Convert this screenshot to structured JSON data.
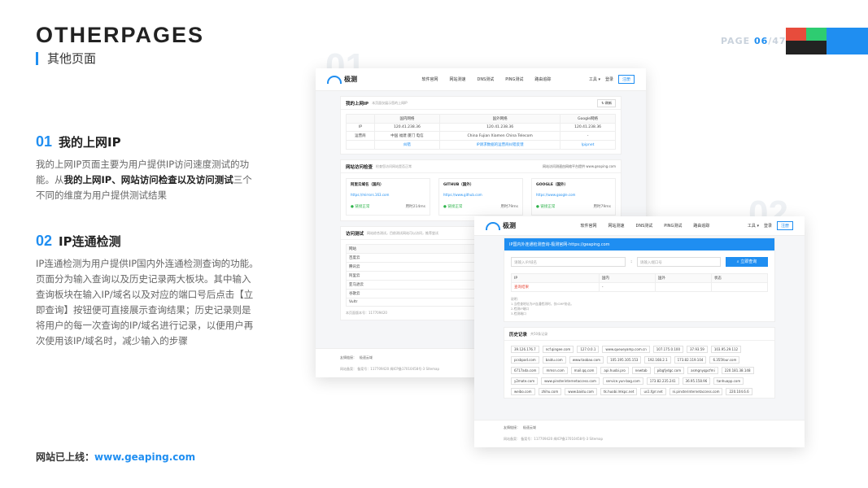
{
  "header": {
    "title_a": "OTHER",
    "title_b": "PAGES",
    "subtitle": "其他页面",
    "page_label": "PAGE",
    "page_current": "06",
    "page_total": "/47",
    "color_blocks": [
      "#e74c3c",
      "#2ecc71",
      "#1f8ef1",
      "#222222"
    ]
  },
  "section1": {
    "num": "01",
    "title": "我的上网IP",
    "body_pre": "我的上网IP页面主要为用户提供IP访问速度测试的功能。从",
    "body_bold": "我的上网IP、网站访问检查以及访问测试",
    "body_post": "三个不同的维度为用户提供测试结果"
  },
  "section2": {
    "num": "02",
    "title": "IP连通检测",
    "body": "IP连通检测为用户提供IP国内外连通检测查询的功能。页面分为输入查询以及历史记录两大板块。其中输入查询板块在输入IP/域名以及对应的端口号后点击【立即查询】按钮便可直接展示查询结果；历史记录则是将用户的每一次查询的IP/域名进行记录，以便用户再次使用该IP/域名时，减少输入的步骤"
  },
  "footer": {
    "label": "网站已上线：",
    "url": "www.geaping.com"
  },
  "shot1": {
    "ghost_num": "01",
    "logo": "极测",
    "nav": [
      "软件官网",
      "网站测速",
      "DNS测试",
      "PING测试",
      "路由追踪"
    ],
    "nav_right": [
      "工具 ▾",
      "登录",
      "注册"
    ],
    "myip": {
      "title": "我的上网IP",
      "subtitle": "本页面仅展示您的上网IP",
      "refresh": "刷新",
      "cols": [
        "",
        "国内网络",
        "国外网络",
        "Google网络"
      ],
      "rows": [
        [
          "IP",
          "120.41.238.36",
          "120.41.238.36",
          "120.41.238.36"
        ],
        [
          "运营商",
          "中国 福建 厦门 电信",
          "China Fujian Xiamen China Telecom",
          "-"
        ],
        [
          "",
          "纠错",
          "IP请求数据的运营商纠错反馈",
          "Ipipnet"
        ]
      ]
    },
    "check": {
      "title": "网站访问检查",
      "subtitle": "检查您访问网站是否正常",
      "right": "网站访问测速由网络平台提供 www.geaping.com",
      "items": [
        {
          "name": "阿里云域名（国内）",
          "url": "https://mirrors.163.com",
          "status": "链接正常",
          "time": "用时214ms"
        },
        {
          "name": "GITHUB（国外）",
          "url": "https://www.github.com",
          "status": "链接正常",
          "time": "用时79ms"
        },
        {
          "name": "GOOGLE（国外）",
          "url": "https://www.google.com",
          "status": "链接正常",
          "time": "用时79ms"
        }
      ]
    },
    "test": {
      "title": "访问测试",
      "subtitle": "网站综合测试，目前测试网站可以访问，推荐尝试",
      "cols": [
        "网站",
        "域名"
      ],
      "rows": [
        [
          "百度云",
          "https://cloud.baidu.com"
        ],
        [
          "腾讯云",
          "https://cloud.tencent.com"
        ],
        [
          "阿里云",
          "https://aliyun.com"
        ],
        [
          "亚马逊云",
          "https://aws.amazon.com"
        ],
        [
          "谷歌云",
          "https://cloud.google.com"
        ],
        [
          "Vultr",
          "https://vultr.com"
        ]
      ],
      "note": "本页面版本号：117709420"
    },
    "footer": [
      "友情链接：",
      "极速云域"
    ],
    "footer2": "网站备案：  备案号：117709420    闽ICP备17010458号-3   Sitemap"
  },
  "shot2": {
    "ghost_num": "02",
    "logo": "极测",
    "nav": [
      "软件官网",
      "网站测速",
      "DNS测试",
      "PING测试",
      "路由追踪"
    ],
    "nav_right": [
      "工具 ▾",
      "登录",
      "注册"
    ],
    "banner": "IP国内外连通检测查询-极测官网-https://geaping.com",
    "ip_placeholder": "请输入IP/域名",
    "port_placeholder": "请输入端口号",
    "query_btn": "立即查询",
    "cols": [
      "IP",
      "国内",
      "国外",
      "状态"
    ],
    "result": [
      "查询结果",
      "-",
      "",
      ""
    ],
    "notes": "说明：\n1.当检查地址为IP连通检测时，仅ICMP协议。\n2.检测IP端口\n3.检测端口",
    "history_title": "历史记录",
    "history_sub": "共50条记录",
    "history": [
      "39.126.176.7",
      "ncf.qingee.com",
      "127.0.0.1",
      "www.queueyamp.com.cn",
      "107.175.0.100",
      "37.93.59",
      "103.95.29.112",
      "pcsbpod.com",
      "baidu.com",
      "www.taobao.com",
      "105.195.105.153",
      "192.168.2.1",
      "173.82.119.104",
      "6.355four.com",
      "6717ada.com",
      "mmsn.com",
      "mail.qq.com",
      "api.huobi.pro",
      "newtab",
      "pibgfydgc.com",
      "asmgnyqpcfmi",
      "220.181.38.148",
      "y2mate.com",
      "www.pinsterinternetaccess.com",
      "service.yun-bag.com",
      "173.82.235.241",
      "36.95.158.96",
      "tanhuapp.com",
      "weibo.com",
      "zhihu.com",
      "www.baidu.com",
      "tk.huobi.lmkpc.net",
      "us1.fgrr.net",
      "ni.pinsterinternetaccess.com",
      "220.104.6.6",
      "www.pz8.com",
      "173.82.184.252",
      "111.42.78.64",
      "sg.huobi.lmkpc.net",
      "www.fast.cn",
      "fuyaya.fuyaya.com",
      "38.99.88.99.69",
      "161.117.176.148",
      "208.67.222.222",
      "108.34.155.202",
      "173.82.202.230",
      "ucmail.qq.com",
      "geaping.com",
      "chrome.google.com",
      "qq.com"
    ],
    "footer": [
      "友情链接：",
      "极速云域"
    ],
    "footer2": "网站备案：  备案号：117709420    闽ICP备17010458号-3   Sitemap"
  }
}
